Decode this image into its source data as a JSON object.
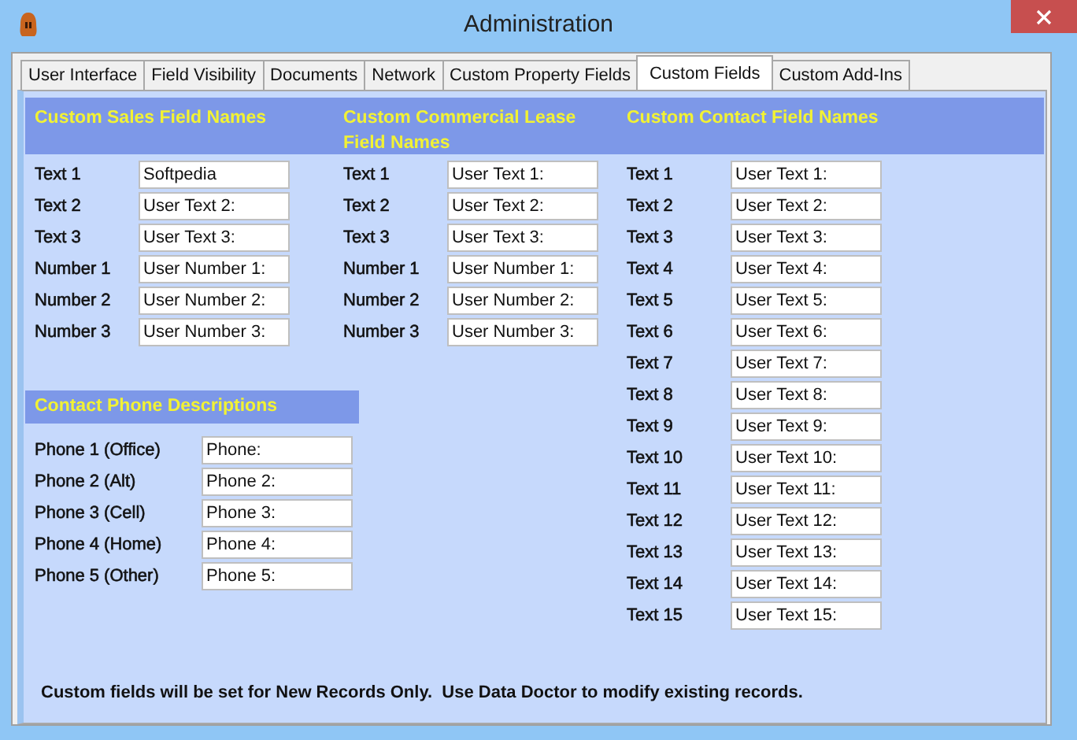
{
  "window": {
    "title": "Administration"
  },
  "tabs": [
    {
      "label": "User Interface",
      "selected": false
    },
    {
      "label": "Field Visibility",
      "selected": false
    },
    {
      "label": "Documents",
      "selected": false
    },
    {
      "label": "Network",
      "selected": false
    },
    {
      "label": "Custom Property Fields",
      "selected": false
    },
    {
      "label": "Custom Fields",
      "selected": true
    },
    {
      "label": "Custom Add-Ins",
      "selected": false
    }
  ],
  "sales": {
    "title": "Custom Sales Field Names",
    "rows": [
      {
        "label": "Text 1",
        "value": "Softpedia"
      },
      {
        "label": "Text 2",
        "value": "User Text 2:"
      },
      {
        "label": "Text 3",
        "value": "User Text 3:"
      },
      {
        "label": "Number 1",
        "value": "User Number 1:"
      },
      {
        "label": "Number 2",
        "value": "User Number 2:"
      },
      {
        "label": "Number 3",
        "value": "User Number 3:"
      }
    ]
  },
  "commercial": {
    "title": "Custom Commercial Lease Field Names",
    "rows": [
      {
        "label": "Text 1",
        "value": "User Text 1:"
      },
      {
        "label": "Text 2",
        "value": "User Text 2:"
      },
      {
        "label": "Text 3",
        "value": "User Text 3:"
      },
      {
        "label": "Number 1",
        "value": "User Number 1:"
      },
      {
        "label": "Number 2",
        "value": "User Number 2:"
      },
      {
        "label": "Number 3",
        "value": "User Number 3:"
      }
    ]
  },
  "contact": {
    "title": "Custom Contact Field Names",
    "rows": [
      {
        "label": "Text 1",
        "value": "User Text 1:"
      },
      {
        "label": "Text 2",
        "value": "User Text 2:"
      },
      {
        "label": "Text 3",
        "value": "User Text 3:"
      },
      {
        "label": "Text 4",
        "value": "User Text 4:"
      },
      {
        "label": "Text 5",
        "value": "User Text 5:"
      },
      {
        "label": "Text 6",
        "value": "User Text 6:"
      },
      {
        "label": "Text 7",
        "value": "User Text 7:"
      },
      {
        "label": "Text 8",
        "value": "User Text 8:"
      },
      {
        "label": "Text 9",
        "value": "User Text 9:"
      },
      {
        "label": "Text 10",
        "value": "User Text 10:"
      },
      {
        "label": "Text 11",
        "value": "User Text 11:"
      },
      {
        "label": "Text 12",
        "value": "User Text 12:"
      },
      {
        "label": "Text 13",
        "value": "User Text 13:"
      },
      {
        "label": "Text 14",
        "value": "User Text 14:"
      },
      {
        "label": "Text 15",
        "value": "User Text 15:"
      }
    ]
  },
  "phone": {
    "title": "Contact Phone Descriptions",
    "rows": [
      {
        "label": "Phone 1 (Office)",
        "value": "Phone:"
      },
      {
        "label": "Phone 2 (Alt)",
        "value": "Phone 2:"
      },
      {
        "label": "Phone 3 (Cell)",
        "value": "Phone 3:"
      },
      {
        "label": "Phone 4 (Home)",
        "value": "Phone 4:"
      },
      {
        "label": "Phone 5 (Other)",
        "value": "Phone 5:"
      }
    ]
  },
  "note": "Custom fields will be set for New Records Only.  Use Data Doctor to modify existing records."
}
